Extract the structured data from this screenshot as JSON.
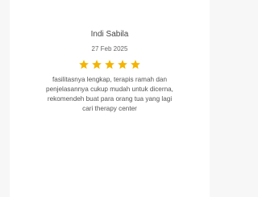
{
  "review": {
    "reviewer_name": "Indi Sabila",
    "date": "27 Feb 2025",
    "rating": 5,
    "rating_max": 5,
    "text": "fasilitasnya lengkap, terapis ramah dan penjelasannya cukup mudah untuk dicerna, rekomendeh buat para orang tua yang lagi cari therapy center"
  },
  "colors": {
    "star": "#f4b400",
    "name_text": "#444444",
    "date_text": "#666666",
    "body_text": "#555555"
  },
  "icons": {
    "star": "star-icon"
  }
}
